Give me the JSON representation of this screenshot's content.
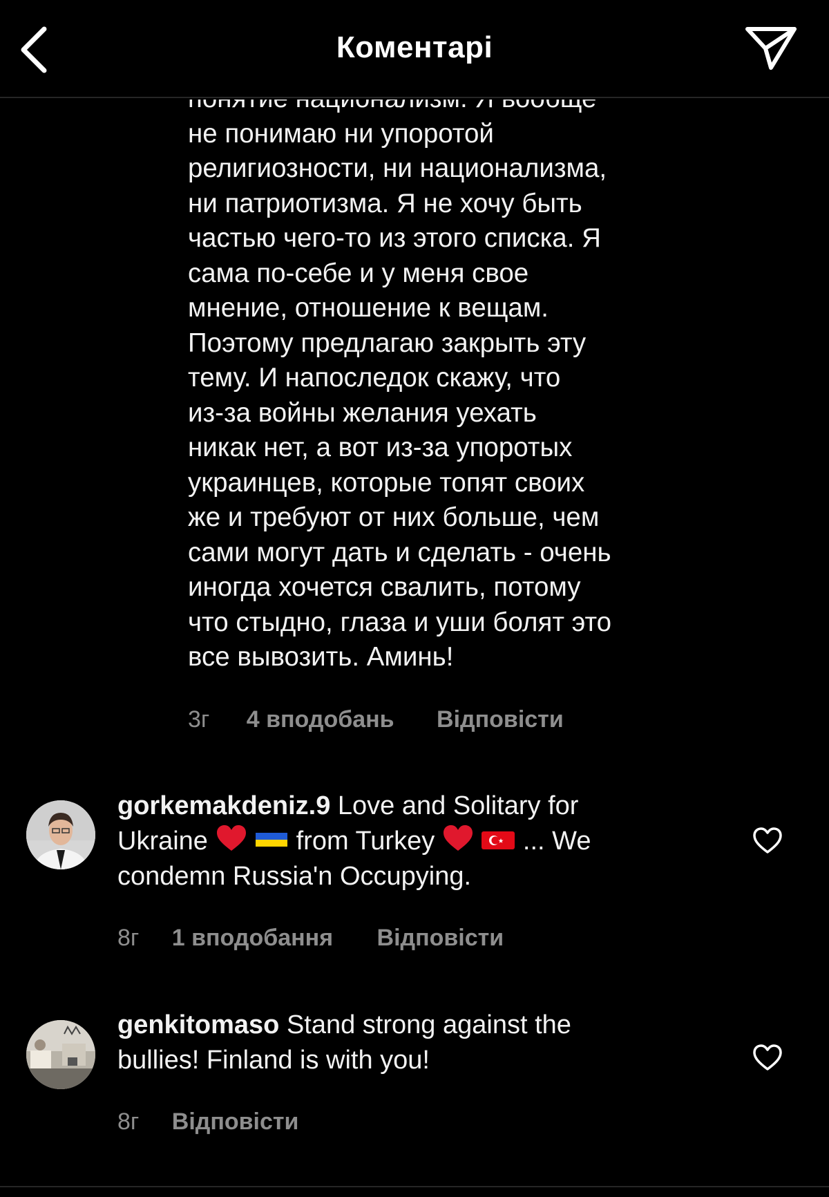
{
  "header": {
    "title": "Коментарі",
    "back_icon": "chevron-left-icon",
    "share_icon": "direct-send-icon"
  },
  "long_comment": {
    "lines": [
      "понятие национализм. Я вообще",
      "не понимаю ни упоротой",
      "религиозности, ни национализма,",
      "ни патриотизма. Я не хочу быть",
      "частью чего-то из этого списка. Я",
      "сама по-себе и у меня свое",
      "мнение, отношение к вещам.",
      "Поэтому предлагаю закрыть эту",
      "тему. И напоследок скажу, что",
      "из-за войны желания уехать",
      "никак нет, а вот из-за упоротых",
      "украинцев, которые топят своих",
      "же и требуют от них больше, чем",
      "сами могут дать и сделать - очень",
      "иногда хочется свалить, потому",
      "что стыдно, глаза и уши болят это",
      "все вывозить. Аминь!"
    ],
    "time": "3г",
    "likes": "4 вподобань",
    "reply": "Відповісти"
  },
  "comments": [
    {
      "username": "gorkemakdeniz.9",
      "text_part1": " Love and Solitary for",
      "text_part2": "Ukraine ",
      "text_part3": " from Turkey ",
      "text_part4": "... We",
      "text_part5": "condemn Russia'n Occupying.",
      "time": "8г",
      "likes": "1 вподобання",
      "reply": "Відповісти",
      "avatar_icon": "user-avatar",
      "like_icon": "heart-outline-icon"
    },
    {
      "username": "genkitomaso",
      "text_part1": " Stand strong against the",
      "text_part2": "bullies! Finland is with you!",
      "time": "8г",
      "reply": "Відповісти",
      "avatar_icon": "user-avatar",
      "like_icon": "heart-outline-icon"
    }
  ],
  "colors": {
    "background": "#000000",
    "text": "#f2f2f2",
    "secondary": "#8e8e8e",
    "divider": "#262626",
    "heart_red": "#e0182d",
    "ukraine_blue": "#1f5bd6",
    "ukraine_yellow": "#ffd500",
    "turkey_red": "#e30a17"
  }
}
